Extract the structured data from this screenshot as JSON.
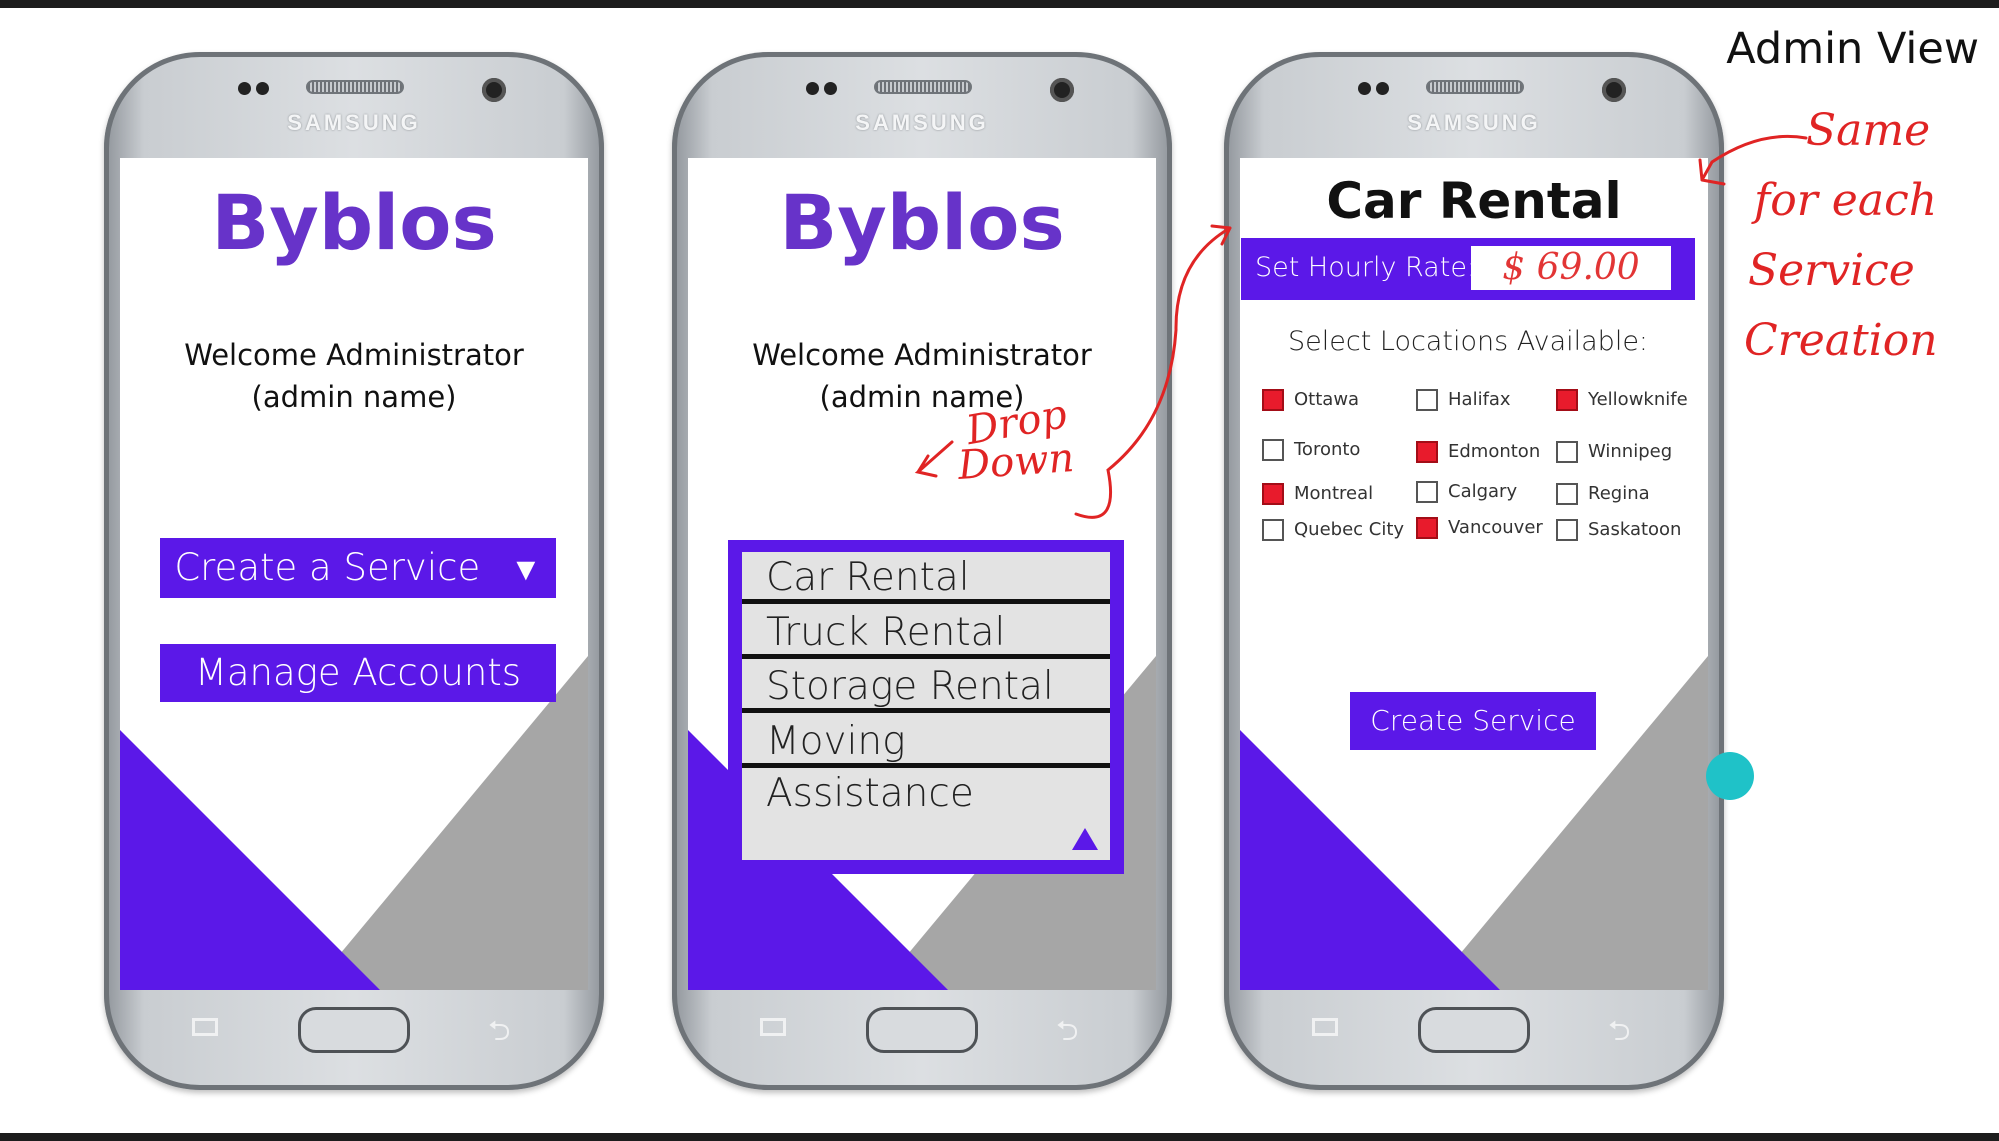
{
  "page_title": "Admin View",
  "phones": [
    {
      "brand": "SAMSUNG",
      "app_title": "Byblos",
      "welcome_line1": "Welcome Administrator",
      "welcome_line2": "(admin name)",
      "create_service_label": "Create a Service",
      "create_service_arrow": "▼",
      "manage_accounts_label": "Manage Accounts"
    },
    {
      "brand": "SAMSUNG",
      "app_title": "Byblos",
      "welcome_line1": "Welcome Administrator",
      "welcome_line2": "(admin name)",
      "dropdown_options": [
        "Car Rental",
        "Truck Rental",
        "Storage Rental",
        "Moving Assistance"
      ]
    },
    {
      "brand": "SAMSUNG",
      "screen_title": "Car Rental",
      "rate_label": "Set Hourly Rate:",
      "rate_value": "$ 69.00",
      "locations_heading": "Select Locations Available:",
      "locations": [
        {
          "name": "Ottawa",
          "checked": true
        },
        {
          "name": "Halifax",
          "checked": false
        },
        {
          "name": "Yellowknife",
          "checked": true
        },
        {
          "name": "Toronto",
          "checked": false
        },
        {
          "name": "Edmonton",
          "checked": true
        },
        {
          "name": "Winnipeg",
          "checked": false
        },
        {
          "name": "Montreal",
          "checked": true
        },
        {
          "name": "Calgary",
          "checked": false
        },
        {
          "name": "Regina",
          "checked": false
        },
        {
          "name": "Quebec City",
          "checked": false
        },
        {
          "name": "Vancouver",
          "checked": true
        },
        {
          "name": "Saskatoon",
          "checked": false
        }
      ],
      "create_service_button": "Create Service"
    }
  ],
  "annotations": {
    "drop_down_line1": "Drop",
    "drop_down_line2": "Down",
    "same_line1": "Same",
    "same_line2": "for each",
    "same_line3": "Service",
    "same_line4": "Creation"
  },
  "colors": {
    "accent_purple": "#5b18e8",
    "title_purple": "#6733c9",
    "annotation_red": "#e02424",
    "grey_panel": "#a6a6a6"
  }
}
